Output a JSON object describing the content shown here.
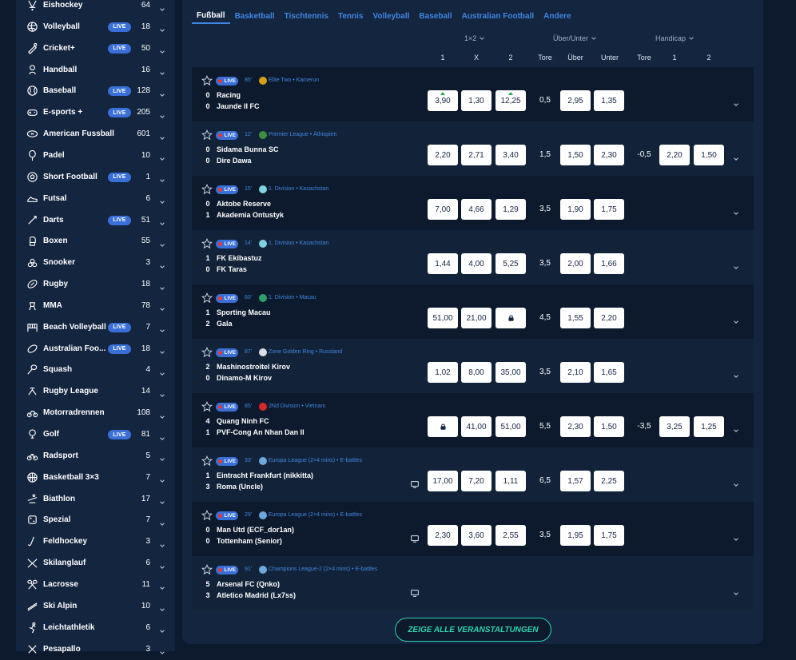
{
  "sidebar": {
    "items": [
      {
        "label": "Eishockey",
        "count": "64",
        "live": false,
        "icon": "hockey-icon"
      },
      {
        "label": "Volleyball",
        "count": "18",
        "live": true,
        "icon": "volleyball-icon"
      },
      {
        "label": "Cricket+",
        "count": "50",
        "live": true,
        "icon": "cricket-icon"
      },
      {
        "label": "Handball",
        "count": "16",
        "live": false,
        "icon": "handball-icon"
      },
      {
        "label": "Baseball",
        "count": "128",
        "live": true,
        "icon": "baseball-icon"
      },
      {
        "label": "E-sports +",
        "count": "205",
        "live": true,
        "icon": "gamepad-icon"
      },
      {
        "label": "American Fussball",
        "count": "601",
        "live": false,
        "icon": "american-football-icon"
      },
      {
        "label": "Padel",
        "count": "10",
        "live": false,
        "icon": "padel-icon"
      },
      {
        "label": "Short Football",
        "count": "1",
        "live": true,
        "icon": "soccer-ball-icon"
      },
      {
        "label": "Futsal",
        "count": "6",
        "live": false,
        "icon": "futsal-shoe-icon"
      },
      {
        "label": "Darts",
        "count": "51",
        "live": true,
        "icon": "dart-icon"
      },
      {
        "label": "Boxen",
        "count": "55",
        "live": false,
        "icon": "boxing-glove-icon"
      },
      {
        "label": "Snooker",
        "count": "3",
        "live": false,
        "icon": "snooker-balls-icon"
      },
      {
        "label": "Rugby",
        "count": "18",
        "live": false,
        "icon": "rugby-ball-icon"
      },
      {
        "label": "MMA",
        "count": "78",
        "live": false,
        "icon": "mma-icon"
      },
      {
        "label": "Beach Volleyball",
        "count": "7",
        "live": true,
        "icon": "beach-volleyball-net-icon"
      },
      {
        "label": "Australian Foo...",
        "count": "18",
        "live": true,
        "icon": "australian-football-icon"
      },
      {
        "label": "Squash",
        "count": "4",
        "live": false,
        "icon": "squash-racket-icon"
      },
      {
        "label": "Rugby League",
        "count": "14",
        "live": false,
        "icon": "rugby-league-icon"
      },
      {
        "label": "Motorradrennen",
        "count": "108",
        "live": false,
        "icon": "motorbike-icon"
      },
      {
        "label": "Golf",
        "count": "81",
        "live": true,
        "icon": "golf-icon"
      },
      {
        "label": "Radsport",
        "count": "5",
        "live": false,
        "icon": "bicycle-icon"
      },
      {
        "label": "Basketball 3×3",
        "count": "7",
        "live": false,
        "icon": "basketball-icon"
      },
      {
        "label": "Biathlon",
        "count": "17",
        "live": false,
        "icon": "biathlon-icon"
      },
      {
        "label": "Spezial",
        "count": "7",
        "live": false,
        "icon": "special-icon"
      },
      {
        "label": "Feldhockey",
        "count": "3",
        "live": false,
        "icon": "field-hockey-icon"
      },
      {
        "label": "Skilanglauf",
        "count": "6",
        "live": false,
        "icon": "ski-icon"
      },
      {
        "label": "Lacrosse",
        "count": "11",
        "live": false,
        "icon": "lacrosse-icon"
      },
      {
        "label": "Ski Alpin",
        "count": "10",
        "live": false,
        "icon": "ski-alpine-icon"
      },
      {
        "label": "Leichtathletik",
        "count": "6",
        "live": false,
        "icon": "athletics-icon"
      },
      {
        "label": "Pesapallo",
        "count": "3",
        "live": false,
        "icon": "pesapallo-icon"
      }
    ],
    "live_label": "LIVE"
  },
  "tabs": [
    "Fußball",
    "Basketball",
    "Tischtennis",
    "Tennis",
    "Volleyball",
    "Baseball",
    "Australian Football",
    "Andere"
  ],
  "headers": {
    "group_1x2": "1×2",
    "group_ou": "Über/Unter",
    "group_hc": "Handicap",
    "col_1": "1",
    "col_x": "X",
    "col_2": "2",
    "col_tore": "Tore",
    "col_uber": "Über",
    "col_unter": "Unter",
    "col_hc_tore": "Tore",
    "col_hc_1": "1",
    "col_hc_2": "2"
  },
  "matches": [
    {
      "minute": "85'",
      "league": "Elite Two",
      "country": "Kamerun",
      "flag_color": "#d4a017",
      "score1": "0",
      "score2": "0",
      "team1": "Racing",
      "team2": "Jaunde II FC",
      "tv": false,
      "o1": "3,90",
      "ox": "1,30",
      "o2": "12,25",
      "up1": true,
      "up2": true,
      "lock1": false,
      "lock2": false,
      "tore": "0,5",
      "over": "2,95",
      "under": "1,35",
      "hc_line": "",
      "hc1": "",
      "hc2": ""
    },
    {
      "minute": "12'",
      "league": "Premier League",
      "country": "Äthiopien",
      "flag_color": "#3e8e41",
      "score1": "0",
      "score2": "0",
      "team1": "Sidama Bunna SC",
      "team2": "Dire Dawa",
      "tv": false,
      "o1": "2,20",
      "ox": "2,71",
      "o2": "3,40",
      "up1": false,
      "up2": false,
      "lock1": false,
      "lock2": false,
      "tore": "1,5",
      "over": "1,50",
      "under": "2,30",
      "hc_line": "-0,5",
      "hc1": "2,20",
      "hc2": "1,50"
    },
    {
      "minute": "15'",
      "league": "1. Division",
      "country": "Kasachstan",
      "flag_color": "#7fd3e0",
      "score1": "0",
      "score2": "1",
      "team1": "Aktobe Reserve",
      "team2": "Akademia Ontustyk",
      "tv": false,
      "o1": "7,00",
      "ox": "4,66",
      "o2": "1,29",
      "up1": false,
      "up2": false,
      "lock1": false,
      "lock2": false,
      "tore": "3,5",
      "over": "1,90",
      "under": "1,75",
      "hc_line": "",
      "hc1": "",
      "hc2": ""
    },
    {
      "minute": "14'",
      "league": "1. Division",
      "country": "Kasachstan",
      "flag_color": "#7fd3e0",
      "score1": "1",
      "score2": "0",
      "team1": "FK Ekibastuz",
      "team2": "FK Taras",
      "tv": false,
      "o1": "1,44",
      "ox": "4,00",
      "o2": "5,25",
      "up1": false,
      "up2": false,
      "lock1": false,
      "lock2": false,
      "tore": "3,5",
      "over": "2,00",
      "under": "1,66",
      "hc_line": "",
      "hc1": "",
      "hc2": ""
    },
    {
      "minute": "60'",
      "league": "1. Division",
      "country": "Macau",
      "flag_color": "#2e9e6a",
      "score1": "1",
      "score2": "2",
      "team1": "Sporting Macau",
      "team2": "Gala",
      "tv": false,
      "o1": "51,00",
      "ox": "21,00",
      "o2": "",
      "up1": false,
      "up2": false,
      "lock1": false,
      "lock2": true,
      "tore": "4,5",
      "over": "1,55",
      "under": "2,20",
      "hc_line": "",
      "hc1": "",
      "hc2": ""
    },
    {
      "minute": "87'",
      "league": "Zone Golden Ring",
      "country": "Russland",
      "flag_color": "#d9dde6",
      "score1": "2",
      "score2": "0",
      "team1": "Mashinostroitel Kirov",
      "team2": "Dinamo-M Kirov",
      "tv": false,
      "o1": "1,02",
      "ox": "8,00",
      "o2": "35,00",
      "up1": false,
      "up2": false,
      "lock1": false,
      "lock2": false,
      "tore": "3,5",
      "over": "2,10",
      "under": "1,65",
      "hc_line": "",
      "hc1": "",
      "hc2": ""
    },
    {
      "minute": "85'",
      "league": "2Nd Division",
      "country": "Vietnam",
      "flag_color": "#d62828",
      "score1": "4",
      "score2": "1",
      "team1": "Quang Ninh FC",
      "team2": "PVF-Cong An Nhan Dan II",
      "tv": false,
      "o1": "",
      "ox": "41,00",
      "o2": "51,00",
      "up1": false,
      "up2": false,
      "lock1": true,
      "lock2": false,
      "tore": "5,5",
      "over": "2,30",
      "under": "1,50",
      "hc_line": "-3,5",
      "hc1": "3,25",
      "hc2": "1,25"
    },
    {
      "minute": "33'",
      "league": "Europa League (2×4 mins)",
      "country": "E-battles",
      "flag_color": "#6fa8dc",
      "score1": "1",
      "score2": "3",
      "team1": "Eintracht Frankfurt (nikkitta)",
      "team2": "Roma (Uncle)",
      "tv": true,
      "o1": "17,00",
      "ox": "7,20",
      "o2": "1,11",
      "up1": false,
      "up2": false,
      "lock1": false,
      "lock2": false,
      "tore": "6,5",
      "over": "1,57",
      "under": "2,25",
      "hc_line": "",
      "hc1": "",
      "hc2": ""
    },
    {
      "minute": "29'",
      "league": "Europa League (2×4 mins)",
      "country": "E-battles",
      "flag_color": "#6fa8dc",
      "score1": "0",
      "score2": "0",
      "team1": "Man Utd (ECF_dor1an)",
      "team2": "Tottenham (Senior)",
      "tv": true,
      "o1": "2,30",
      "ox": "3,60",
      "o2": "2,55",
      "up1": false,
      "up2": false,
      "lock1": false,
      "lock2": false,
      "tore": "3,5",
      "over": "1,95",
      "under": "1,75",
      "hc_line": "",
      "hc1": "",
      "hc2": ""
    },
    {
      "minute": "91'",
      "league": "Champions League-2 (2×4 mins)",
      "country": "E-battles",
      "flag_color": "#6fa8dc",
      "score1": "5",
      "score2": "3",
      "team1": "Arsenal FC (Qnko)",
      "team2": "Atletico Madrid (Lx7ss)",
      "tv": true,
      "o1": "",
      "ox": "",
      "o2": "",
      "up1": false,
      "up2": false,
      "lock1": false,
      "lock2": false,
      "tore": "",
      "over": "",
      "under": "",
      "hc_line": "",
      "hc1": "",
      "hc2": ""
    }
  ],
  "match_live_label": "LIVE",
  "show_all_label": "ZEIGE ALLE VERANSTALTUNGEN",
  "colors": {
    "background": "#0d1a2d",
    "panel": "#142540",
    "accent_blue": "#3f86e0",
    "live_badge": "#3a6fd8",
    "cta_teal": "#2cd3b0",
    "odds_up": "#2ba84a"
  }
}
